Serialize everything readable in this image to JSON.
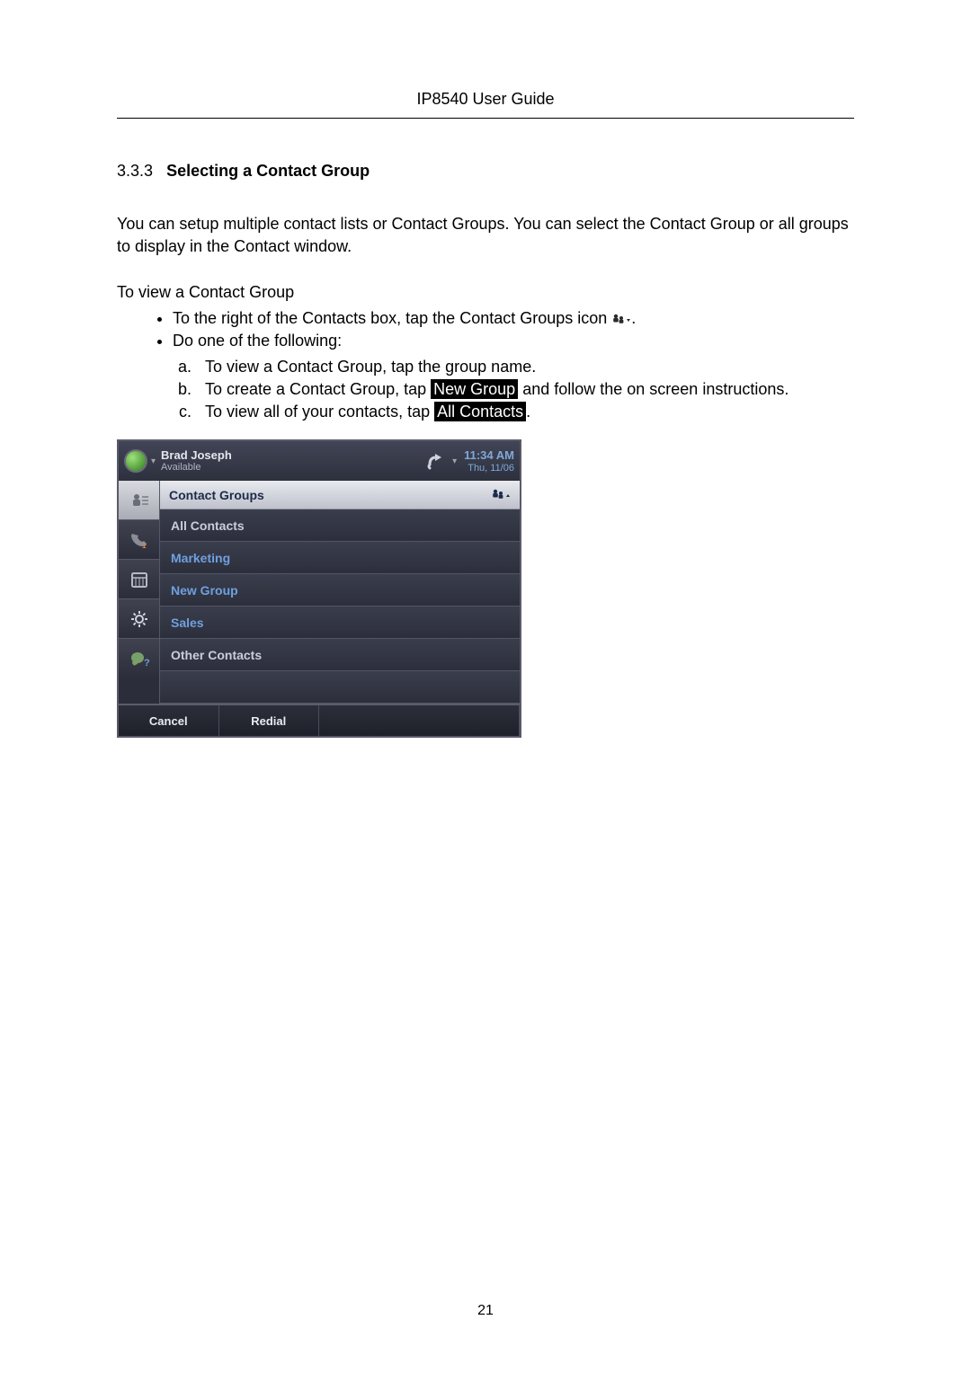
{
  "header": "IP8540 User Guide",
  "section": {
    "number": "3.3.3",
    "title": "Selecting a Contact Group"
  },
  "para1": "You can setup multiple contact lists or Contact Groups.  You can select the Contact Group or all groups to display in the Contact window.",
  "intro": "To view a Contact Group",
  "bullet1_prefix": "To the right of the Contacts box, tap the Contact Groups icon",
  "bullet1_suffix": ".",
  "bullet2": "Do one of the following:",
  "step_a": "To view a Contact Group, tap the group name.",
  "step_b_prefix": "To create a Contact Group, tap ",
  "step_b_tag": "New Group",
  "step_b_suffix": " and follow the on screen instructions.",
  "step_c_prefix": "To view all of your contacts, tap ",
  "step_c_tag": "All Contacts",
  "step_c_suffix": ".",
  "phone": {
    "user_name": "Brad Joseph",
    "user_status": "Available",
    "time": "11:34 AM",
    "date": "Thu, 11/06",
    "content_title": "Contact Groups",
    "items": {
      "all": "All Contacts",
      "marketing": "Marketing",
      "newgroup": "New Group",
      "sales": "Sales",
      "other": "Other Contacts"
    },
    "softkeys": {
      "cancel": "Cancel",
      "redial": "Redial"
    }
  },
  "page_number": "21"
}
